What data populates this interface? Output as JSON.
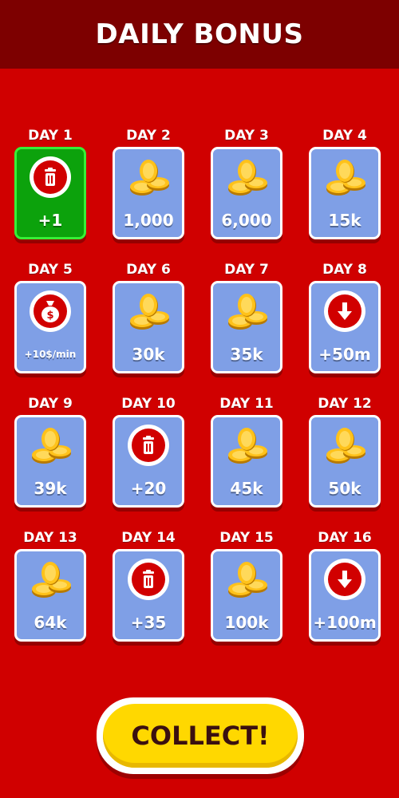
{
  "header": {
    "title": "DAILY BONUS"
  },
  "days": [
    {
      "label": "DAY 1",
      "reward": "+1",
      "icon": "trash-icon",
      "claimed": true
    },
    {
      "label": "DAY 2",
      "reward": "1,000",
      "icon": "coins-icon"
    },
    {
      "label": "DAY 3",
      "reward": "6,000",
      "icon": "coins-icon"
    },
    {
      "label": "DAY 4",
      "reward": "15k",
      "icon": "coins-icon"
    },
    {
      "label": "DAY 5",
      "reward": "+10$/min",
      "icon": "money-bag-icon"
    },
    {
      "label": "DAY 6",
      "reward": "30k",
      "icon": "coins-icon"
    },
    {
      "label": "DAY 7",
      "reward": "35k",
      "icon": "coins-icon"
    },
    {
      "label": "DAY 8",
      "reward": "+50m",
      "icon": "arrow-down-icon"
    },
    {
      "label": "DAY 9",
      "reward": "39k",
      "icon": "coins-icon"
    },
    {
      "label": "DAY 10",
      "reward": "+20",
      "icon": "trash-icon"
    },
    {
      "label": "DAY 11",
      "reward": "45k",
      "icon": "coins-icon"
    },
    {
      "label": "DAY 12",
      "reward": "50k",
      "icon": "coins-icon"
    },
    {
      "label": "DAY 13",
      "reward": "64k",
      "icon": "coins-icon"
    },
    {
      "label": "DAY 14",
      "reward": "+35",
      "icon": "trash-icon"
    },
    {
      "label": "DAY 15",
      "reward": "100k",
      "icon": "coins-icon"
    },
    {
      "label": "DAY 16",
      "reward": "+100m",
      "icon": "arrow-down-icon"
    }
  ],
  "collect_button": {
    "label": "COLLECT!"
  },
  "colors": {
    "background": "#d00000",
    "header": "#7d0000",
    "card": "#7f9fe6",
    "card_active": "#0ca20c",
    "button": "#ffd800"
  }
}
